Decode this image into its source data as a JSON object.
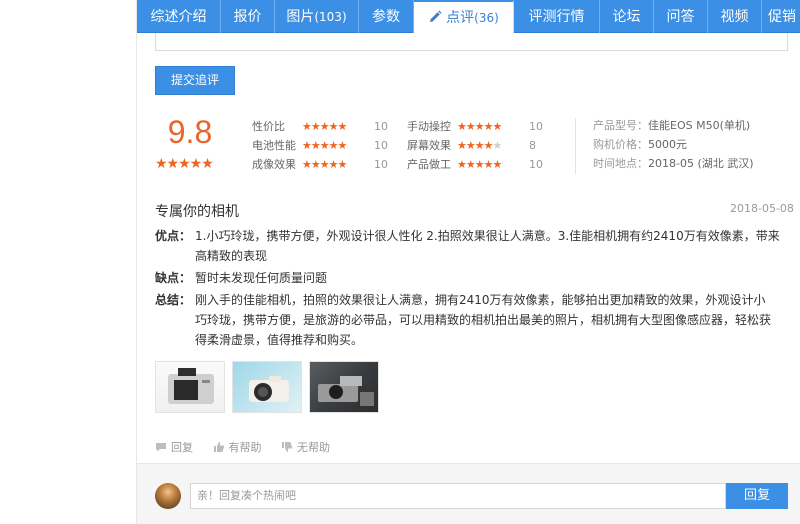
{
  "tabs": [
    {
      "label": "综述介绍",
      "count": ""
    },
    {
      "label": "报价",
      "count": ""
    },
    {
      "label": "图片",
      "count": "(103)"
    },
    {
      "label": "参数",
      "count": ""
    },
    {
      "label": "点评",
      "count": "(36)"
    },
    {
      "label": "评测行情",
      "count": ""
    },
    {
      "label": "论坛",
      "count": ""
    },
    {
      "label": "问答",
      "count": ""
    },
    {
      "label": "视频",
      "count": ""
    },
    {
      "label": "促销",
      "count": ""
    }
  ],
  "active_tab": "点评",
  "submit_label": "提交追评",
  "overall_score": "9.8",
  "ratings": [
    {
      "label": "性价比",
      "stars": 5,
      "value": "10"
    },
    {
      "label": "电池性能",
      "stars": 5,
      "value": "10"
    },
    {
      "label": "成像效果",
      "stars": 5,
      "value": "10"
    },
    {
      "label": "手动操控",
      "stars": 5,
      "value": "10"
    },
    {
      "label": "屏幕效果",
      "stars": 4,
      "value": "8"
    },
    {
      "label": "产品做工",
      "stars": 5,
      "value": "10"
    }
  ],
  "meta": {
    "model_key": "产品型号：",
    "model": "佳能EOS M50(单机)",
    "price_key": "购机价格：",
    "price": "5000元",
    "place_key": "时间地点：",
    "place": "2018-05  (湖北 武汉)"
  },
  "review": {
    "title": "专属你的相机",
    "date": "2018-05-08",
    "pros_key": "优点：",
    "pros_line1": "1.小巧玲珑，携带方便，外观设计很人性化 2.拍照效果很让人满意。3.佳能相机拥有约2410万有效像素，带来",
    "pros_line2": "高精致的表现",
    "cons_key": "缺点：",
    "cons": "暂时未发现任何质量问题",
    "summary_key": "总结：",
    "summary_line1": "刚入手的佳能相机，拍照的效果很让人满意，拥有2410万有效像素，能够拍出更加精致的效果，外观设计小",
    "summary_line2": "巧玲珑，携带方便，是旅游的必带品，可以用精致的相机拍出最美的照片，相机拥有大型图像感应器，轻松获",
    "summary_line3": "得柔滑虚景，值得推荐和购买。"
  },
  "actions": {
    "reply": "回复",
    "helpful": "有帮助",
    "unhelpful": "无帮助"
  },
  "reply_box": {
    "placeholder": "亲！回复凑个热闹吧",
    "button": "回复"
  },
  "colors": {
    "accent": "#3b8fe4",
    "score": "#e8652a",
    "star": "#f0641e"
  }
}
